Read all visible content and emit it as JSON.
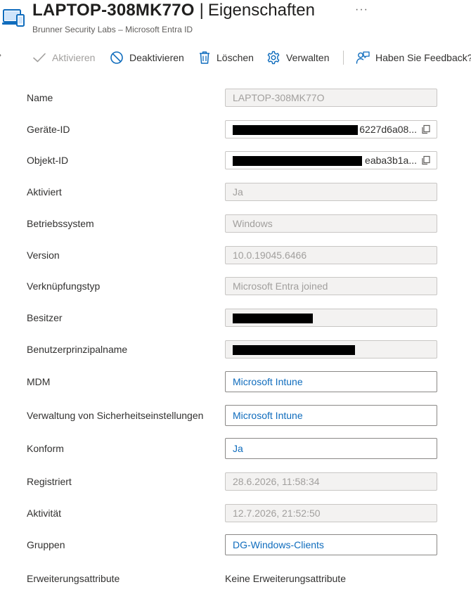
{
  "header": {
    "device_name": "LAPTOP-308MK77O",
    "separator": "|",
    "page_name": "Eigenschaften",
    "more": "···",
    "subtitle": "Brunner Security Labs – Microsoft Entra ID"
  },
  "toolbar": {
    "enable_label": "Aktivieren",
    "disable_label": "Deaktivieren",
    "delete_label": "Löschen",
    "manage_label": "Verwalten",
    "feedback_label": "Haben Sie Feedback?"
  },
  "properties": {
    "name": {
      "label": "Name",
      "value": "LAPTOP-308MK77O"
    },
    "device_id": {
      "label": "Geräte-ID",
      "value_tail": "6227d6a08..."
    },
    "object_id": {
      "label": "Objekt-ID",
      "value_tail": "eaba3b1a..."
    },
    "enabled": {
      "label": "Aktiviert",
      "value": "Ja"
    },
    "os": {
      "label": "Betriebssystem",
      "value": "Windows"
    },
    "version": {
      "label": "Version",
      "value": "10.0.19045.6466"
    },
    "join_type": {
      "label": "Verknüpfungstyp",
      "value": "Microsoft Entra joined"
    },
    "owner": {
      "label": "Besitzer"
    },
    "upn": {
      "label": "Benutzerprinzipalname"
    },
    "mdm": {
      "label": "MDM",
      "value": "Microsoft Intune"
    },
    "security_mgmt": {
      "label": "Verwaltung von Sicherheitseinstellungen",
      "value": "Microsoft Intune"
    },
    "compliant": {
      "label": "Konform",
      "value": "Ja"
    },
    "registered": {
      "label": "Registriert",
      "value": "28.6.2026, 11:58:34"
    },
    "activity": {
      "label": "Aktivität",
      "value": "12.7.2026, 21:52:50"
    },
    "groups": {
      "label": "Gruppen",
      "value": "DG-Windows-Clients"
    },
    "extension_attrs": {
      "label": "Erweiterungsattribute",
      "value": "Keine Erweiterungsattribute"
    }
  },
  "colors": {
    "link": "#0f6cbd",
    "disabled_text": "#a19f9d",
    "icon_blue": "#0f6cbd"
  }
}
